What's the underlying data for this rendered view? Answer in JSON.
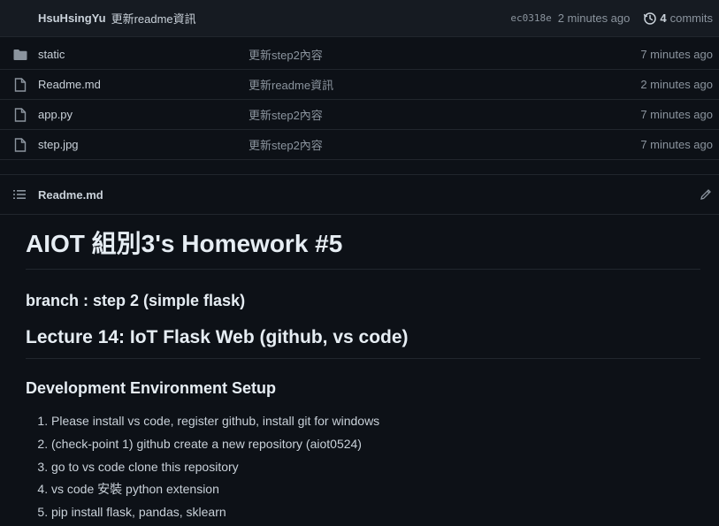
{
  "commit": {
    "author": "HsuHsingYu",
    "message": "更新readme資訊",
    "sha": "ec0318e",
    "time": "2 minutes ago",
    "count": "4",
    "commits_label": "commits"
  },
  "files": [
    {
      "name": "static",
      "message": "更新step2內容",
      "time": "7 minutes ago",
      "icon": "folder-icon"
    },
    {
      "name": "Readme.md",
      "message": "更新readme資訊",
      "time": "2 minutes ago",
      "icon": "file-icon"
    },
    {
      "name": "app.py",
      "message": "更新step2內容",
      "time": "7 minutes ago",
      "icon": "file-icon"
    },
    {
      "name": "step.jpg",
      "message": "更新step2內容",
      "time": "7 minutes ago",
      "icon": "file-icon"
    }
  ],
  "readme": {
    "filename": "Readme.md",
    "h1": "AIOT 組別3's Homework #5",
    "branch": "branch : step 2 (simple flask)",
    "lecture": "Lecture 14: IoT Flask Web (github, vs code)",
    "section": "Development Environment Setup",
    "steps": [
      "Please install vs code, register github, install git for windows",
      "(check-point 1) github create a new repository (aiot0524)",
      "go to vs code clone this repository",
      "vs code 安裝 python extension",
      "pip install flask, pandas, sklearn"
    ]
  },
  "colors": {
    "background": "#0d1117",
    "header_bg": "#161b22",
    "text": "#c9d1d9",
    "muted": "#8b949e",
    "border": "#21262d"
  }
}
